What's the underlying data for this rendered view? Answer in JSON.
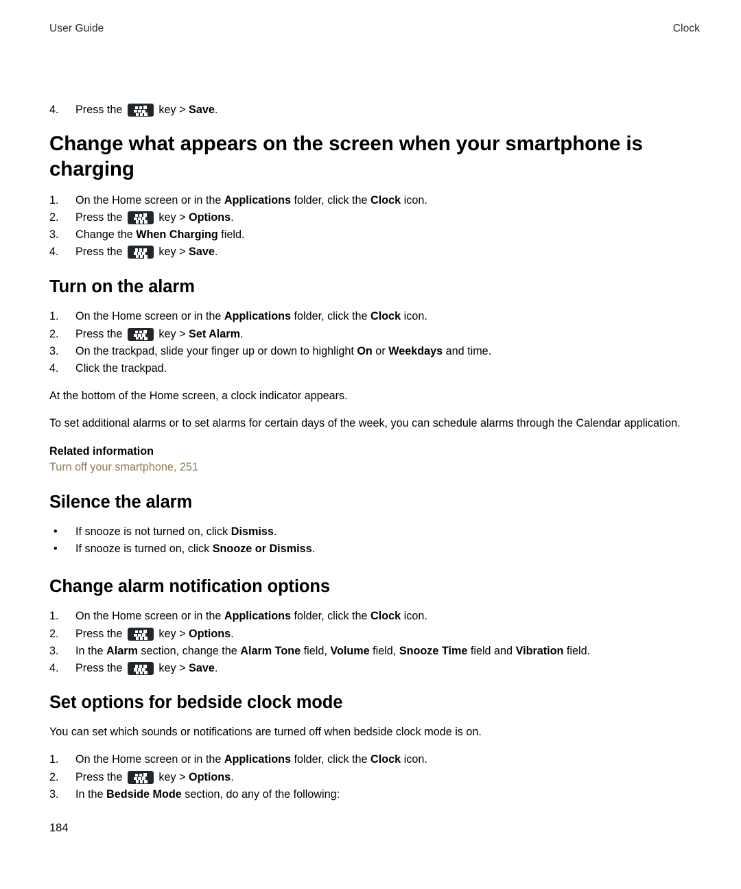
{
  "header": {
    "left": "User Guide",
    "right": "Clock"
  },
  "footer": {
    "page_number": "184"
  },
  "icons": {
    "menu_key": "blackberry-menu-key-icon"
  },
  "colors": {
    "link": "#8a7d4e",
    "text": "#000000",
    "key_icon_bg": "#22272e",
    "page_bg": "#ffffff"
  },
  "intro_step": {
    "number": "4.",
    "pre": "Press the",
    "mid": "key >",
    "bold": "Save",
    "post": "."
  },
  "sections": [
    {
      "id": "change-what-appears",
      "level": "h1",
      "title": "Change what appears on the screen when your smartphone is charging",
      "steps": [
        {
          "number": "1.",
          "parts": [
            {
              "t": "On the Home screen or in the ",
              "b": false
            },
            {
              "t": "Applications",
              "b": true
            },
            {
              "t": " folder, click the ",
              "b": false
            },
            {
              "t": "Clock",
              "b": true
            },
            {
              "t": " icon.",
              "b": false
            }
          ]
        },
        {
          "number": "2.",
          "parts": [
            {
              "t": "Press the ",
              "b": false
            },
            {
              "t": "__KEY__",
              "b": false
            },
            {
              "t": " key > ",
              "b": false
            },
            {
              "t": "Options",
              "b": true
            },
            {
              "t": ".",
              "b": false
            }
          ]
        },
        {
          "number": "3.",
          "parts": [
            {
              "t": "Change the ",
              "b": false
            },
            {
              "t": "When Charging",
              "b": true
            },
            {
              "t": " field.",
              "b": false
            }
          ]
        },
        {
          "number": "4.",
          "parts": [
            {
              "t": "Press the ",
              "b": false
            },
            {
              "t": "__KEY__",
              "b": false
            },
            {
              "t": " key > ",
              "b": false
            },
            {
              "t": "Save",
              "b": true
            },
            {
              "t": ".",
              "b": false
            }
          ]
        }
      ]
    },
    {
      "id": "turn-on-the-alarm",
      "level": "h2",
      "title": "Turn on the alarm",
      "steps": [
        {
          "number": "1.",
          "parts": [
            {
              "t": "On the Home screen or in the ",
              "b": false
            },
            {
              "t": "Applications",
              "b": true
            },
            {
              "t": " folder, click the ",
              "b": false
            },
            {
              "t": "Clock",
              "b": true
            },
            {
              "t": " icon.",
              "b": false
            }
          ]
        },
        {
          "number": "2.",
          "parts": [
            {
              "t": " Press the ",
              "b": false
            },
            {
              "t": "__KEY__",
              "b": false
            },
            {
              "t": " key > ",
              "b": false
            },
            {
              "t": "Set Alarm",
              "b": true
            },
            {
              "t": ".",
              "b": false
            }
          ]
        },
        {
          "number": "3.",
          "parts": [
            {
              "t": "On the trackpad, slide your finger up or down to highlight ",
              "b": false
            },
            {
              "t": "On",
              "b": true
            },
            {
              "t": " or ",
              "b": false
            },
            {
              "t": "Weekdays",
              "b": true
            },
            {
              "t": " and time.",
              "b": false
            }
          ]
        },
        {
          "number": "4.",
          "parts": [
            {
              "t": "Click the trackpad.",
              "b": false
            }
          ]
        }
      ],
      "paragraphs": [
        "At the bottom of the Home screen, a clock indicator appears.",
        "To set additional alarms or to set alarms for certain days of the week, you can schedule alarms through the Calendar application."
      ],
      "related": {
        "label": "Related information",
        "links": [
          "Turn off your smartphone, 251"
        ]
      }
    },
    {
      "id": "silence-the-alarm",
      "level": "h2",
      "title": "Silence the alarm",
      "bullets": [
        {
          "parts": [
            {
              "t": "If snooze is not turned on, click ",
              "b": false
            },
            {
              "t": "Dismiss",
              "b": true
            },
            {
              "t": ".",
              "b": false
            }
          ]
        },
        {
          "parts": [
            {
              "t": "If snooze is turned on, click ",
              "b": false
            },
            {
              "t": "Snooze or Dismiss",
              "b": true
            },
            {
              "t": ".",
              "b": false
            }
          ]
        }
      ]
    },
    {
      "id": "change-alarm-notification-options",
      "level": "h2",
      "title": "Change alarm notification options",
      "steps": [
        {
          "number": "1.",
          "parts": [
            {
              "t": "On the Home screen or in the ",
              "b": false
            },
            {
              "t": "Applications",
              "b": true
            },
            {
              "t": " folder, click the ",
              "b": false
            },
            {
              "t": "Clock",
              "b": true
            },
            {
              "t": " icon.",
              "b": false
            }
          ]
        },
        {
          "number": "2.",
          "parts": [
            {
              "t": "Press the ",
              "b": false
            },
            {
              "t": "__KEY__",
              "b": false
            },
            {
              "t": " key > ",
              "b": false
            },
            {
              "t": "Options",
              "b": true
            },
            {
              "t": ".",
              "b": false
            }
          ]
        },
        {
          "number": "3.",
          "parts": [
            {
              "t": "In the ",
              "b": false
            },
            {
              "t": "Alarm",
              "b": true
            },
            {
              "t": " section, change the ",
              "b": false
            },
            {
              "t": "Alarm Tone",
              "b": true
            },
            {
              "t": " field, ",
              "b": false
            },
            {
              "t": "Volume",
              "b": true
            },
            {
              "t": " field, ",
              "b": false
            },
            {
              "t": "Snooze Time",
              "b": true
            },
            {
              "t": " field and ",
              "b": false
            },
            {
              "t": "Vibration",
              "b": true
            },
            {
              "t": " field.",
              "b": false
            }
          ]
        },
        {
          "number": "4.",
          "parts": [
            {
              "t": "Press the ",
              "b": false
            },
            {
              "t": "__KEY__",
              "b": false
            },
            {
              "t": " key > ",
              "b": false
            },
            {
              "t": "Save",
              "b": true
            },
            {
              "t": ".",
              "b": false
            }
          ]
        }
      ]
    },
    {
      "id": "set-options-bedside-clock-mode",
      "level": "h2",
      "title": "Set options for bedside clock mode",
      "paragraphs": [
        "You can set which sounds or notifications are turned off when bedside clock mode is on."
      ],
      "steps": [
        {
          "number": "1.",
          "parts": [
            {
              "t": "On the Home screen or in the ",
              "b": false
            },
            {
              "t": "Applications",
              "b": true
            },
            {
              "t": " folder, click the ",
              "b": false
            },
            {
              "t": "Clock",
              "b": true
            },
            {
              "t": " icon.",
              "b": false
            }
          ]
        },
        {
          "number": "2.",
          "parts": [
            {
              "t": "Press the ",
              "b": false
            },
            {
              "t": "__KEY__",
              "b": false
            },
            {
              "t": " key > ",
              "b": false
            },
            {
              "t": "Options",
              "b": true
            },
            {
              "t": ".",
              "b": false
            }
          ]
        },
        {
          "number": "3.",
          "parts": [
            {
              "t": "In the ",
              "b": false
            },
            {
              "t": "Bedside Mode",
              "b": true
            },
            {
              "t": " section, do any of the following:",
              "b": false
            }
          ]
        }
      ]
    }
  ]
}
